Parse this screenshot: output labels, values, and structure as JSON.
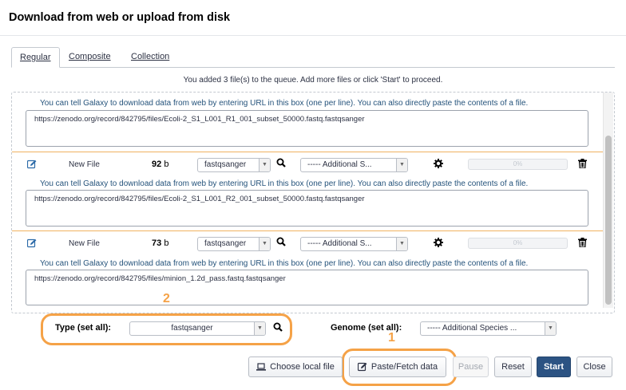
{
  "dialog": {
    "title": "Download from web or upload from disk"
  },
  "tabs": [
    {
      "label": "Regular",
      "active": true
    },
    {
      "label": "Composite",
      "active": false
    },
    {
      "label": "Collection",
      "active": false
    }
  ],
  "queue_info": "You added 3 file(s) to the queue. Add more files or click 'Start' to proceed.",
  "hint_text": "You can tell Galaxy to download data from web by entering URL in this box (one per line). You can also directly paste the contents of a file.",
  "uploads": [
    {
      "url": "https://zenodo.org/record/842795/files/Ecoli-2_S1_L001_R1_001_subset_50000.fastq.fastqsanger"
    },
    {
      "name": "New File",
      "size_num": "92",
      "size_unit": "b",
      "type": "fastqsanger",
      "genome": "----- Additional S...",
      "progress": "0%",
      "url": "https://zenodo.org/record/842795/files/Ecoli-2_S1_L001_R2_001_subset_50000.fastq.fastqsanger"
    },
    {
      "name": "New File",
      "size_num": "73",
      "size_unit": "b",
      "type": "fastqsanger",
      "genome": "----- Additional S...",
      "progress": "0%",
      "url": "https://zenodo.org/record/842795/files/minion_1.2d_pass.fastq.fastqsanger"
    }
  ],
  "set_all": {
    "type_label": "Type (set all):",
    "type_value": "fastqsanger",
    "genome_label": "Genome (set all):",
    "genome_value": "----- Additional Species ..."
  },
  "annotations": {
    "one": "1",
    "two": "2"
  },
  "buttons": {
    "choose_local": "Choose local file",
    "paste_fetch": "Paste/Fetch data",
    "pause": "Pause",
    "reset": "Reset",
    "start": "Start",
    "close": "Close"
  },
  "colors": {
    "accent": "#f5a247",
    "primary": "#2c5383",
    "hint": "#25537b"
  }
}
